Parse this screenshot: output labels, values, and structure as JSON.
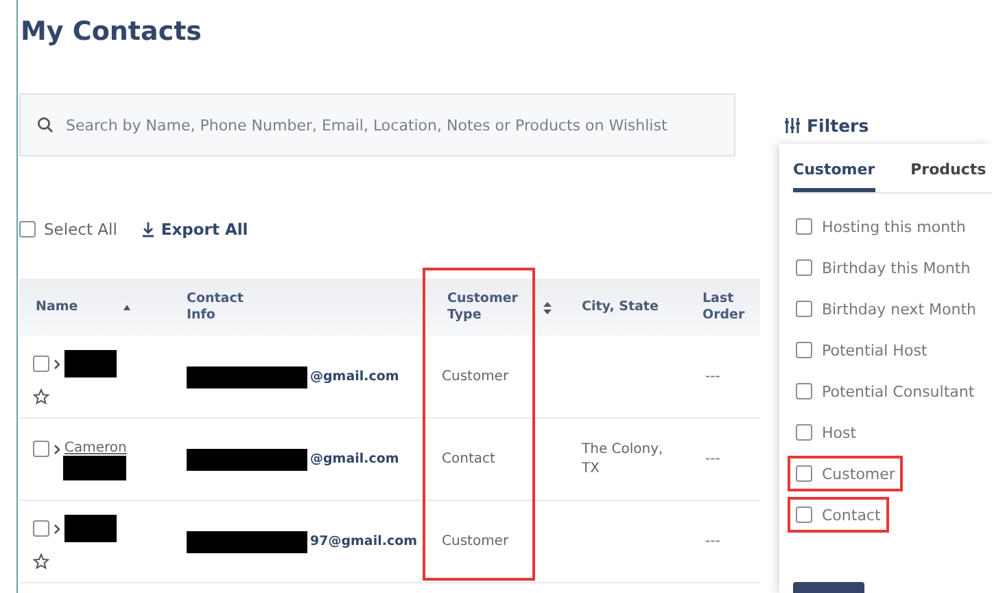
{
  "title": "My Contacts",
  "search": {
    "placeholder": "Search by Name, Phone Number, Email, Location, Notes or Products on Wishlist"
  },
  "select_all": {
    "label": "Select All",
    "checked": false
  },
  "export": {
    "label": "Export All"
  },
  "table": {
    "columns": [
      {
        "label": "Name",
        "highlighted": false,
        "sorted": true,
        "sortable": false
      },
      {
        "label": "Contact Info",
        "highlighted": false,
        "sorted": false,
        "sortable": false
      },
      {
        "label": "Customer Type",
        "highlighted": true,
        "sorted": false,
        "sortable": true
      },
      {
        "label": "City, State",
        "highlighted": false,
        "sorted": false,
        "sortable": false
      },
      {
        "label": "Last Order",
        "highlighted": false,
        "sorted": false,
        "sortable": false
      }
    ],
    "rows": [
      {
        "checked": false,
        "has_star": true,
        "email": "@gmail.com",
        "type": "Customer",
        "last_order": "---"
      },
      {
        "checked": false,
        "name": "Cameron",
        "has_star": false,
        "email": "@gmail.com",
        "type": "Contact",
        "city": "The Colony, TX",
        "last_order": "---"
      },
      {
        "checked": false,
        "has_star": true,
        "email": "97@gmail.com",
        "type": "Customer",
        "last_order": "---"
      }
    ]
  },
  "filters": {
    "title": "Filters",
    "tabs": [
      {
        "label": "Customer",
        "selected": true
      },
      {
        "label": "Products",
        "selected": false
      }
    ],
    "options": [
      {
        "label": "Hosting this month",
        "checked": false,
        "highlighted": false
      },
      {
        "label": "Birthday this Month",
        "checked": false,
        "highlighted": false
      },
      {
        "label": "Birthday next Month",
        "checked": false,
        "highlighted": false
      },
      {
        "label": "Potential Host",
        "checked": false,
        "highlighted": false
      },
      {
        "label": "Potential Consultant",
        "checked": false,
        "highlighted": false
      },
      {
        "label": "Host",
        "checked": false,
        "highlighted": false
      },
      {
        "label": "Customer",
        "checked": false,
        "highlighted": true
      },
      {
        "label": "Contact",
        "checked": false,
        "highlighted": true
      }
    ]
  }
}
